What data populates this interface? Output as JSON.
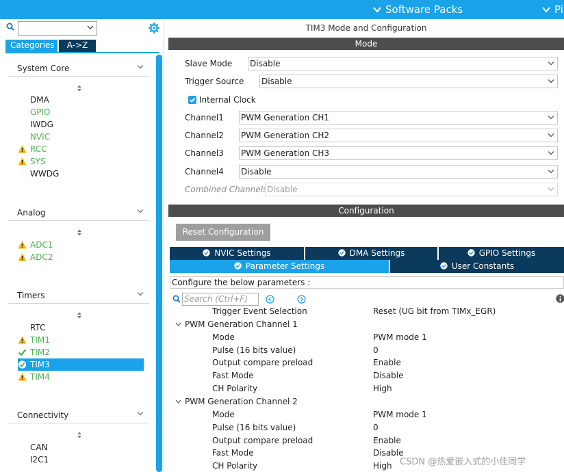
{
  "topbar": {
    "software_packs": "Software Packs",
    "pinout_partial": "Pi"
  },
  "left_panel": {
    "tabs": {
      "categories": "Categories",
      "az": "A->Z"
    },
    "sections": [
      {
        "title": "System Core",
        "items": [
          {
            "label": "DMA",
            "status": "none"
          },
          {
            "label": "GPIO",
            "status": "configured"
          },
          {
            "label": "IWDG",
            "status": "none"
          },
          {
            "label": "NVIC",
            "status": "configured"
          },
          {
            "label": "RCC",
            "status": "warning"
          },
          {
            "label": "SYS",
            "status": "warning"
          },
          {
            "label": "WWDG",
            "status": "none"
          }
        ]
      },
      {
        "title": "Analog",
        "items": [
          {
            "label": "ADC1",
            "status": "warning"
          },
          {
            "label": "ADC2",
            "status": "warning"
          }
        ]
      },
      {
        "title": "Timers",
        "items": [
          {
            "label": "RTC",
            "status": "none"
          },
          {
            "label": "TIM1",
            "status": "warning"
          },
          {
            "label": "TIM2",
            "status": "ok"
          },
          {
            "label": "TIM3",
            "status": "selected"
          },
          {
            "label": "TIM4",
            "status": "warning"
          }
        ]
      },
      {
        "title": "Connectivity",
        "items": [
          {
            "label": "CAN",
            "status": "none"
          },
          {
            "label": "I2C1",
            "status": "none"
          }
        ]
      }
    ]
  },
  "mode": {
    "window_title": "TIM3 Mode and Configuration",
    "bar_title": "Mode",
    "rows": [
      {
        "label": "Slave Mode",
        "value": "Disable",
        "disabled": false
      },
      {
        "label": "Trigger Source",
        "value": "Disable",
        "disabled": false
      },
      {
        "label": "Channel1",
        "value": "PWM Generation CH1",
        "disabled": false
      },
      {
        "label": "Channel2",
        "value": "PWM Generation CH2",
        "disabled": false
      },
      {
        "label": "Channel3",
        "value": "PWM Generation CH3",
        "disabled": false
      },
      {
        "label": "Channel4",
        "value": "Disable",
        "disabled": false
      },
      {
        "label": "Combined Channels",
        "value": "Disable",
        "disabled": true
      }
    ],
    "internal_clock": {
      "label": "Internal Clock",
      "checked": true
    }
  },
  "configuration": {
    "bar_title": "Configuration",
    "reset_button": "Reset Configuration",
    "tabs_row1": [
      "NVIC Settings",
      "DMA Settings",
      "GPIO Settings"
    ],
    "tabs_row2": [
      "Parameter Settings",
      "User Constants"
    ],
    "description": "Configure the below parameters :",
    "search_placeholder": "Search (Ctrl+F)",
    "params": [
      {
        "type": "row",
        "key": "Trigger Event Selection",
        "value": "Reset (UG bit from TIMx_EGR)"
      },
      {
        "type": "group",
        "key": "PWM Generation Channel 1"
      },
      {
        "type": "row",
        "key": "Mode",
        "value": "PWM mode 1"
      },
      {
        "type": "row",
        "key": "Pulse (16 bits value)",
        "value": "0"
      },
      {
        "type": "row",
        "key": "Output compare preload",
        "value": "Enable"
      },
      {
        "type": "row",
        "key": "Fast Mode",
        "value": "Disable"
      },
      {
        "type": "row",
        "key": "CH Polarity",
        "value": "High"
      },
      {
        "type": "group",
        "key": "PWM Generation Channel 2"
      },
      {
        "type": "row",
        "key": "Mode",
        "value": "PWM mode 1"
      },
      {
        "type": "row",
        "key": "Pulse (16 bits value)",
        "value": "0"
      },
      {
        "type": "row",
        "key": "Output compare preload",
        "value": "Enable"
      },
      {
        "type": "row",
        "key": "Fast Mode",
        "value": "Disable"
      },
      {
        "type": "row",
        "key": "CH Polarity",
        "value": "High"
      }
    ]
  },
  "watermark": "CSDN @热爱嵌入式的小佳同学",
  "colors": {
    "accent": "#1aa3e8",
    "dark_tab": "#0b3a5c",
    "bar": "#4d4d4d",
    "configured": "#4caf50",
    "warning": "#f5b400"
  }
}
